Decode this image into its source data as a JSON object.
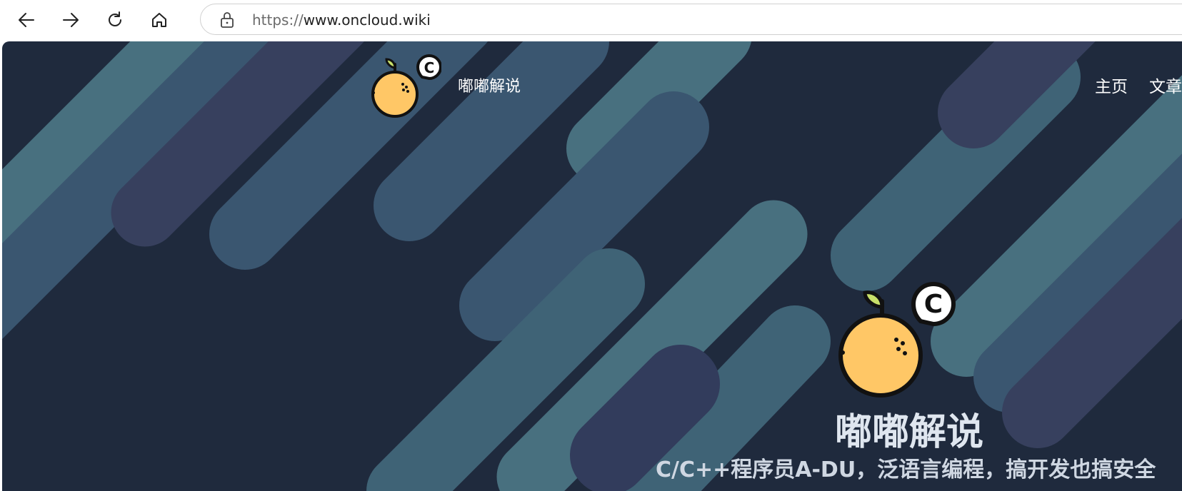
{
  "browser": {
    "url_protocol": "https://",
    "url_host": "www.oncloud.wiki",
    "icons": {
      "back": "back-arrow-icon",
      "forward": "forward-arrow-icon",
      "reload": "reload-icon",
      "home": "home-icon",
      "security": "lock-icon"
    }
  },
  "site": {
    "name": "嘟嘟解说",
    "nav": [
      {
        "label": "主页"
      },
      {
        "label": "文章"
      }
    ]
  },
  "hero": {
    "title": "嘟嘟解说",
    "subtitle": "C/C++程序员A-DU，泛语言编程，搞开发也搞安全"
  },
  "colors": {
    "background": "#1f2a3d",
    "stripe_teal": "#48707f",
    "stripe_blue": "#3a5670",
    "stripe_purple": "#37405e",
    "orange": "#ffc766",
    "leaf": "#c8e06a"
  }
}
